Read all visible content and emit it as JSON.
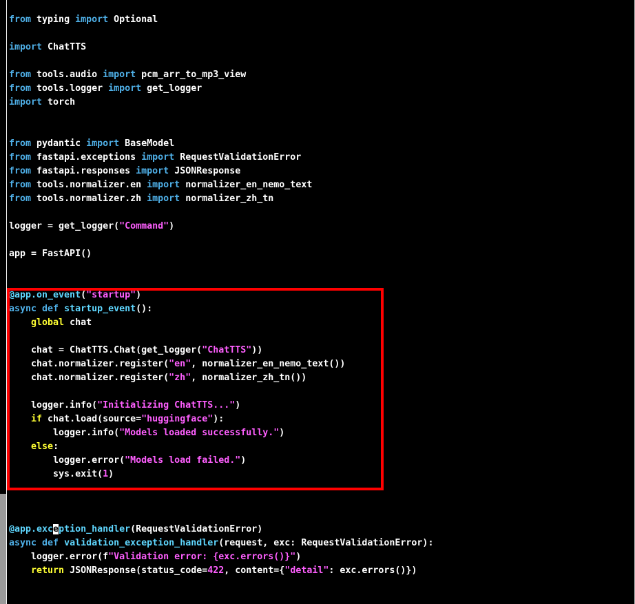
{
  "editor": {
    "cursor": {
      "line": 37,
      "col": 6,
      "char": "e"
    },
    "lines": [
      [
        [
          "from",
          "kw"
        ],
        [
          " typing ",
          ""
        ],
        [
          "import",
          "kw"
        ],
        [
          " Optional",
          ""
        ]
      ],
      [],
      [
        [
          "import",
          "kw"
        ],
        [
          " ChatTTS",
          ""
        ]
      ],
      [],
      [
        [
          "from",
          "kw"
        ],
        [
          " tools.audio ",
          ""
        ],
        [
          "import",
          "kw"
        ],
        [
          " pcm_arr_to_mp3_view",
          ""
        ]
      ],
      [
        [
          "from",
          "kw"
        ],
        [
          " tools.logger ",
          ""
        ],
        [
          "import",
          "kw"
        ],
        [
          " get_logger",
          ""
        ]
      ],
      [
        [
          "import",
          "kw"
        ],
        [
          " torch",
          ""
        ]
      ],
      [],
      [],
      [
        [
          "from",
          "kw"
        ],
        [
          " pydantic ",
          ""
        ],
        [
          "import",
          "kw"
        ],
        [
          " BaseModel",
          ""
        ]
      ],
      [
        [
          "from",
          "kw"
        ],
        [
          " fastapi.exceptions ",
          ""
        ],
        [
          "import",
          "kw"
        ],
        [
          " RequestValidationError",
          ""
        ]
      ],
      [
        [
          "from",
          "kw"
        ],
        [
          " fastapi.responses ",
          ""
        ],
        [
          "import",
          "kw"
        ],
        [
          " JSONResponse",
          ""
        ]
      ],
      [
        [
          "from",
          "kw"
        ],
        [
          " tools.normalizer.en ",
          ""
        ],
        [
          "import",
          "kw"
        ],
        [
          " normalizer_en_nemo_text",
          ""
        ]
      ],
      [
        [
          "from",
          "kw"
        ],
        [
          " tools.normalizer.zh ",
          ""
        ],
        [
          "import",
          "kw"
        ],
        [
          " normalizer_zh_tn",
          ""
        ]
      ],
      [],
      [
        [
          "logger = get_logger(",
          ""
        ],
        [
          "\"Command\"",
          "str"
        ],
        [
          ")",
          ""
        ]
      ],
      [],
      [
        [
          "app = FastAPI()",
          ""
        ]
      ],
      [],
      [],
      [
        [
          "@app.on_event",
          "dec"
        ],
        [
          "(",
          ""
        ],
        [
          "\"startup\"",
          "str"
        ],
        [
          ")",
          ""
        ]
      ],
      [
        [
          "async def",
          "kw"
        ],
        [
          " ",
          ""
        ],
        [
          "startup_event",
          "dec"
        ],
        [
          "():",
          ""
        ]
      ],
      [
        [
          "    ",
          ""
        ],
        [
          "global",
          "flow"
        ],
        [
          " chat",
          ""
        ]
      ],
      [],
      [
        [
          "    chat = ChatTTS.Chat(get_logger(",
          ""
        ],
        [
          "\"ChatTTS\"",
          "str"
        ],
        [
          "))",
          ""
        ]
      ],
      [
        [
          "    chat.normalizer.register(",
          ""
        ],
        [
          "\"en\"",
          "str"
        ],
        [
          ", normalizer_en_nemo_text())",
          ""
        ]
      ],
      [
        [
          "    chat.normalizer.register(",
          ""
        ],
        [
          "\"zh\"",
          "str"
        ],
        [
          ", normalizer_zh_tn())",
          ""
        ]
      ],
      [],
      [
        [
          "    logger.info(",
          ""
        ],
        [
          "\"Initializing ChatTTS...\"",
          "str"
        ],
        [
          ")",
          ""
        ]
      ],
      [
        [
          "    ",
          ""
        ],
        [
          "if",
          "flow"
        ],
        [
          " chat.load(source=",
          ""
        ],
        [
          "\"huggingface\"",
          "str"
        ],
        [
          "):",
          ""
        ]
      ],
      [
        [
          "        logger.info(",
          ""
        ],
        [
          "\"Models loaded successfully.\"",
          "str"
        ],
        [
          ")",
          ""
        ]
      ],
      [
        [
          "    ",
          ""
        ],
        [
          "else",
          "flow"
        ],
        [
          ":",
          ""
        ]
      ],
      [
        [
          "        logger.error(",
          ""
        ],
        [
          "\"Models load failed.\"",
          "str"
        ],
        [
          ")",
          ""
        ]
      ],
      [
        [
          "        sys.exit(",
          ""
        ],
        [
          "1",
          "num"
        ],
        [
          ")",
          ""
        ]
      ],
      [],
      [],
      [],
      [
        [
          "@app.exc",
          "dec"
        ],
        [
          "e",
          "cursor"
        ],
        [
          "ption_handler",
          "dec"
        ],
        [
          "(RequestValidationError)",
          ""
        ]
      ],
      [
        [
          "async def",
          "kw"
        ],
        [
          " ",
          ""
        ],
        [
          "validation_exception_handler",
          "dec"
        ],
        [
          "(request, exc: RequestValidationError):",
          ""
        ]
      ],
      [
        [
          "    logger.error(f",
          ""
        ],
        [
          "\"Validation error: {exc.errors()}\"",
          "str"
        ],
        [
          ")",
          ""
        ]
      ],
      [
        [
          "    ",
          ""
        ],
        [
          "return",
          "flow"
        ],
        [
          " JSONResponse(status_code=",
          ""
        ],
        [
          "422",
          "num"
        ],
        [
          ", content={",
          ""
        ],
        [
          "\"detail\"",
          "str"
        ],
        [
          ": exc.errors()})",
          ""
        ]
      ]
    ]
  },
  "annotation": {
    "color": "#ff0000",
    "covers_lines": "21-34"
  },
  "colors": {
    "background": "#000000",
    "keyword": "#4fb0e8",
    "decorator_function": "#5fd7ff",
    "string": "#ff5fff",
    "flow": "#ffff33",
    "text": "#ffffff"
  }
}
